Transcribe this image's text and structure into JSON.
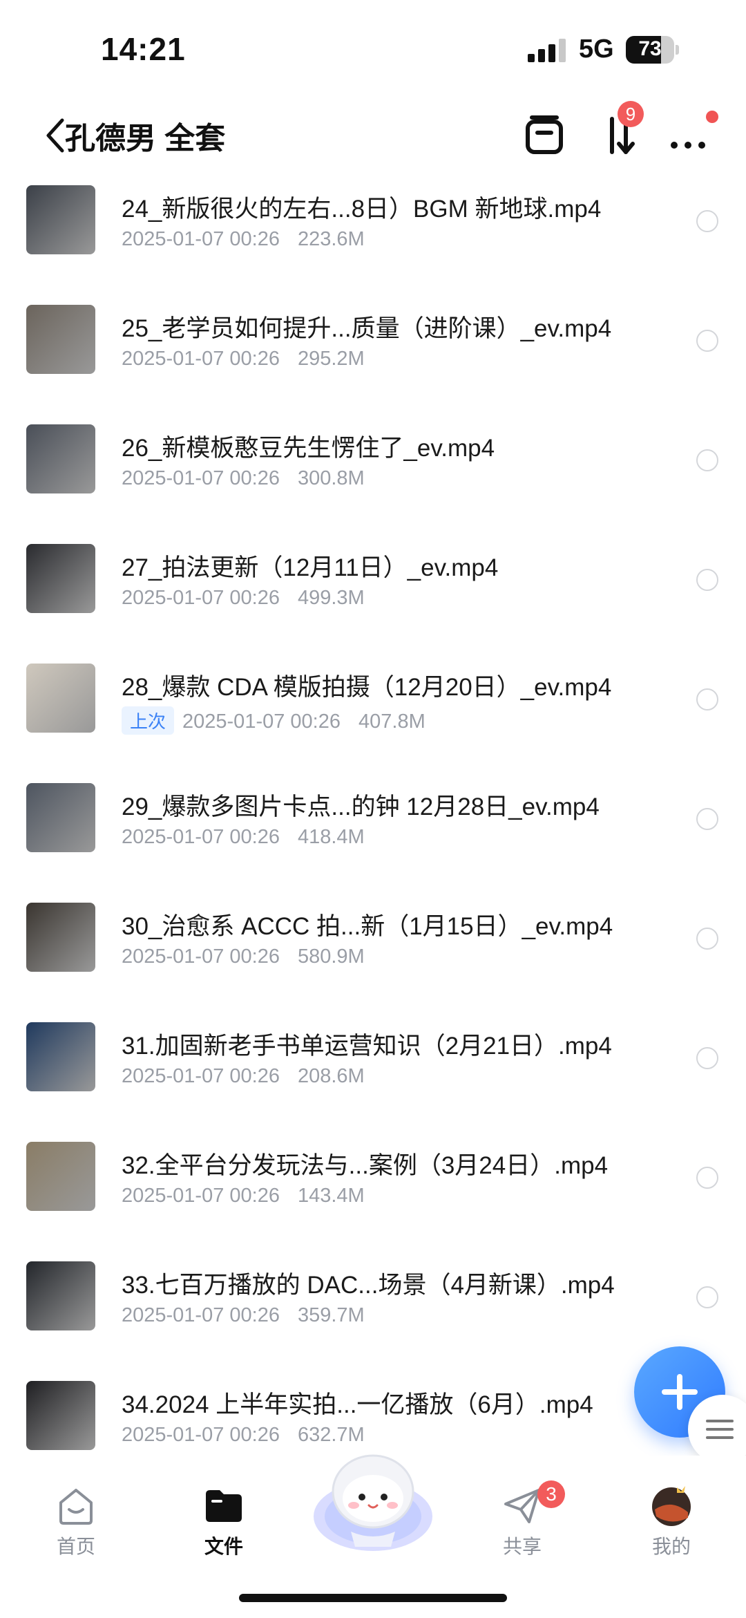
{
  "status_bar": {
    "time": "14:21",
    "network": "5G",
    "battery": "73",
    "battery_level": 0.73
  },
  "header": {
    "title": "孔德男 全套",
    "transfer_badge": "9"
  },
  "files": [
    {
      "name": "24_新版很火的左右...8日）BGM 新地球.mp4",
      "date": "2025-01-07 00:26",
      "size": "223.6M",
      "thumb_color": "#3b4048"
    },
    {
      "name": "25_老学员如何提升...质量（进阶课）_ev.mp4",
      "date": "2025-01-07 00:26",
      "size": "295.2M",
      "thumb_color": "#6b645c"
    },
    {
      "name": "26_新模板憨豆先生愣住了_ev.mp4",
      "date": "2025-01-07 00:26",
      "size": "300.8M",
      "thumb_color": "#4a4f58"
    },
    {
      "name": "27_拍法更新（12月11日）_ev.mp4",
      "date": "2025-01-07 00:26",
      "size": "499.3M",
      "thumb_color": "#2a2b2f"
    },
    {
      "name": "28_爆款 CDA 模版拍摄（12月20日）_ev.mp4",
      "tag": "上次",
      "date": "2025-01-07 00:26",
      "size": "407.8M",
      "thumb_color": "#cfc8bd"
    },
    {
      "name": "29_爆款多图片卡点...的钟 12月28日_ev.mp4",
      "date": "2025-01-07 00:26",
      "size": "418.4M",
      "thumb_color": "#4e5560"
    },
    {
      "name": "30_治愈系 ACCC 拍...新（1月15日）_ev.mp4",
      "date": "2025-01-07 00:26",
      "size": "580.9M",
      "thumb_color": "#3a3530"
    },
    {
      "name": "31.加固新老手书单运营知识（2月21日）.mp4",
      "date": "2025-01-07 00:26",
      "size": "208.6M",
      "thumb_color": "#203a5e"
    },
    {
      "name": "32.全平台分发玩法与...案例（3月24日）.mp4",
      "date": "2025-01-07 00:26",
      "size": "143.4M",
      "thumb_color": "#8a7d66"
    },
    {
      "name": "33.七百万播放的 DAC...场景（4月新课）.mp4",
      "date": "2025-01-07 00:26",
      "size": "359.7M",
      "thumb_color": "#23262b"
    },
    {
      "name": "34.2024 上半年实拍...一亿播放（6月）.mp4",
      "date": "2025-01-07 00:26",
      "size": "632.7M",
      "thumb_color": "#1f1f22"
    }
  ],
  "tabbar": {
    "home": "首页",
    "files": "文件",
    "share": "共享",
    "share_badge": "3",
    "me": "我的"
  }
}
